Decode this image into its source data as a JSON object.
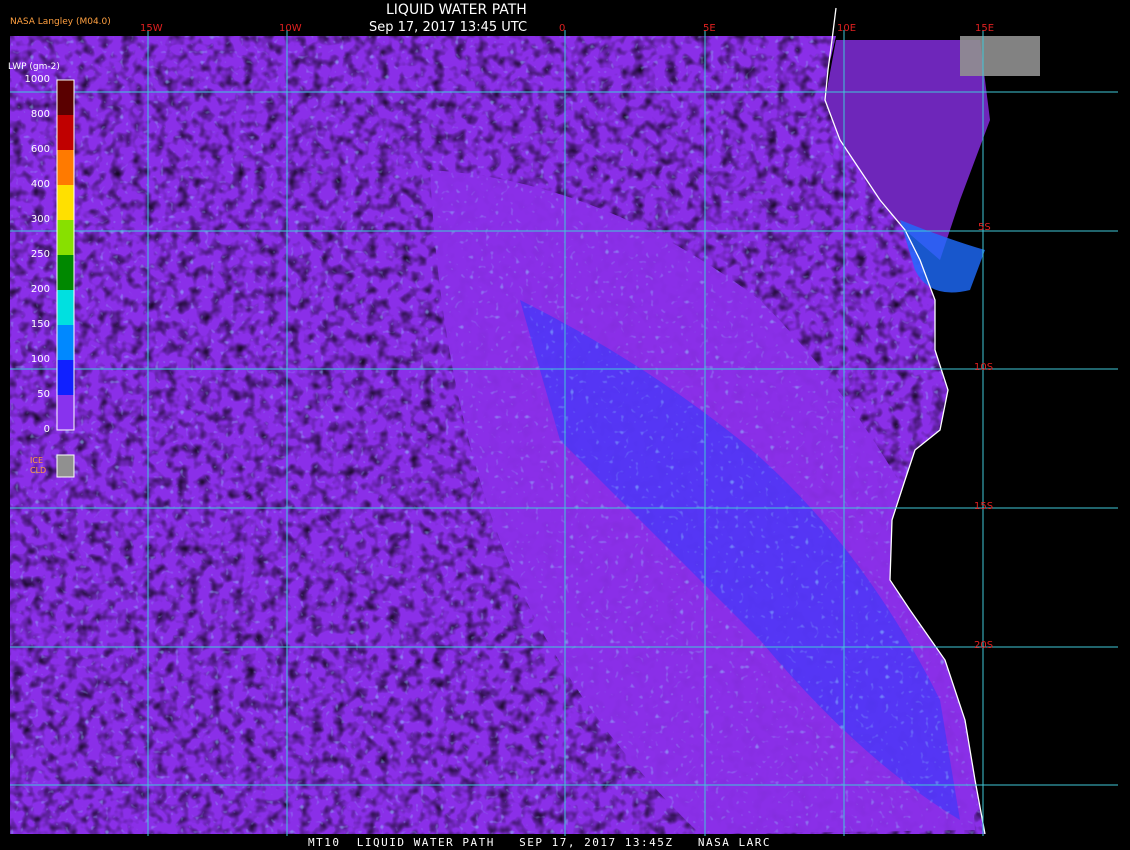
{
  "header": {
    "title": "LIQUID WATER PATH",
    "datetime": "Sep 17, 2017 13:45 UTC",
    "credit": "NASA Langley (M04.0)"
  },
  "footer": {
    "text": "MT10  LIQUID WATER PATH   SEP 17, 2017 13:45Z   NASA LARC"
  },
  "legend": {
    "title": "LWP (gm-2)",
    "levels": [
      {
        "label": "1000",
        "color": "#5a0000"
      },
      {
        "label": "800",
        "color": "#c00000"
      },
      {
        "label": "600",
        "color": "#ff7a00"
      },
      {
        "label": "400",
        "color": "#ffe000"
      },
      {
        "label": "300",
        "color": "#88e000"
      },
      {
        "label": "250",
        "color": "#008800"
      },
      {
        "label": "200",
        "color": "#00e0e0"
      },
      {
        "label": "150",
        "color": "#0088ff"
      },
      {
        "label": "100",
        "color": "#1020ff"
      },
      {
        "label": "50",
        "color": "#8833ee"
      },
      {
        "label": "0",
        "color": ""
      }
    ],
    "ice_label_1": "ICE",
    "ice_label_2": "CLD",
    "ice_color": "#909090"
  },
  "grid": {
    "longitudes": [
      "15W",
      "10W",
      "0",
      "5E",
      "10E",
      "15E"
    ],
    "latitudes": [
      "5S",
      "10S",
      "15S",
      "20S"
    ],
    "grid_color": "#3fc8d8"
  },
  "colors": {
    "background": "#000000",
    "coastline": "#ffffff",
    "label_lat_lon": "#e02020"
  }
}
